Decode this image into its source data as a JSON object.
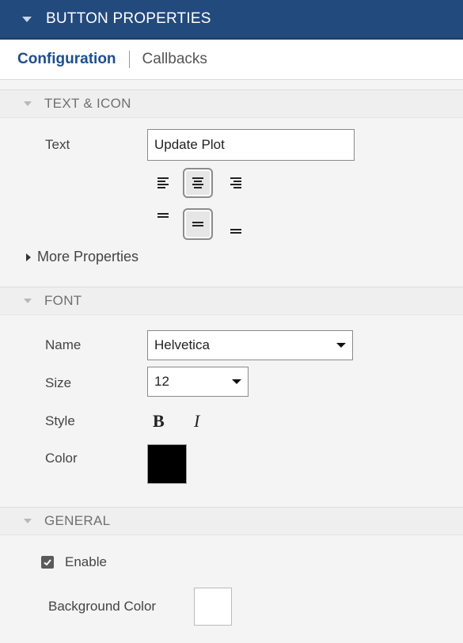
{
  "header": {
    "title": "BUTTON PROPERTIES"
  },
  "tabs": [
    {
      "label": "Configuration",
      "active": true
    },
    {
      "label": "Callbacks",
      "active": false
    }
  ],
  "sections": {
    "text_icon": {
      "title": "TEXT & ICON",
      "text_label": "Text",
      "text_value": "Update Plot",
      "horizontal_alignment": [
        "left",
        "center",
        "right"
      ],
      "horizontal_selected": "center",
      "vertical_alignment": [
        "top",
        "center",
        "bottom"
      ],
      "vertical_selected": "center",
      "more_properties": "More Properties"
    },
    "font": {
      "title": "FONT",
      "name_label": "Name",
      "name_value": "Helvetica",
      "size_label": "Size",
      "size_value": "12",
      "style_label": "Style",
      "bold_glyph": "B",
      "italic_glyph": "I",
      "color_label": "Color",
      "color_value": "#000000"
    },
    "general": {
      "title": "GENERAL",
      "enable_label": "Enable",
      "enable_checked": true,
      "bg_color_label": "Background Color",
      "bg_color_value": "#ffffff"
    }
  },
  "colors": {
    "header_bg": "#234a7c",
    "tab_active": "#1d4f8e"
  }
}
